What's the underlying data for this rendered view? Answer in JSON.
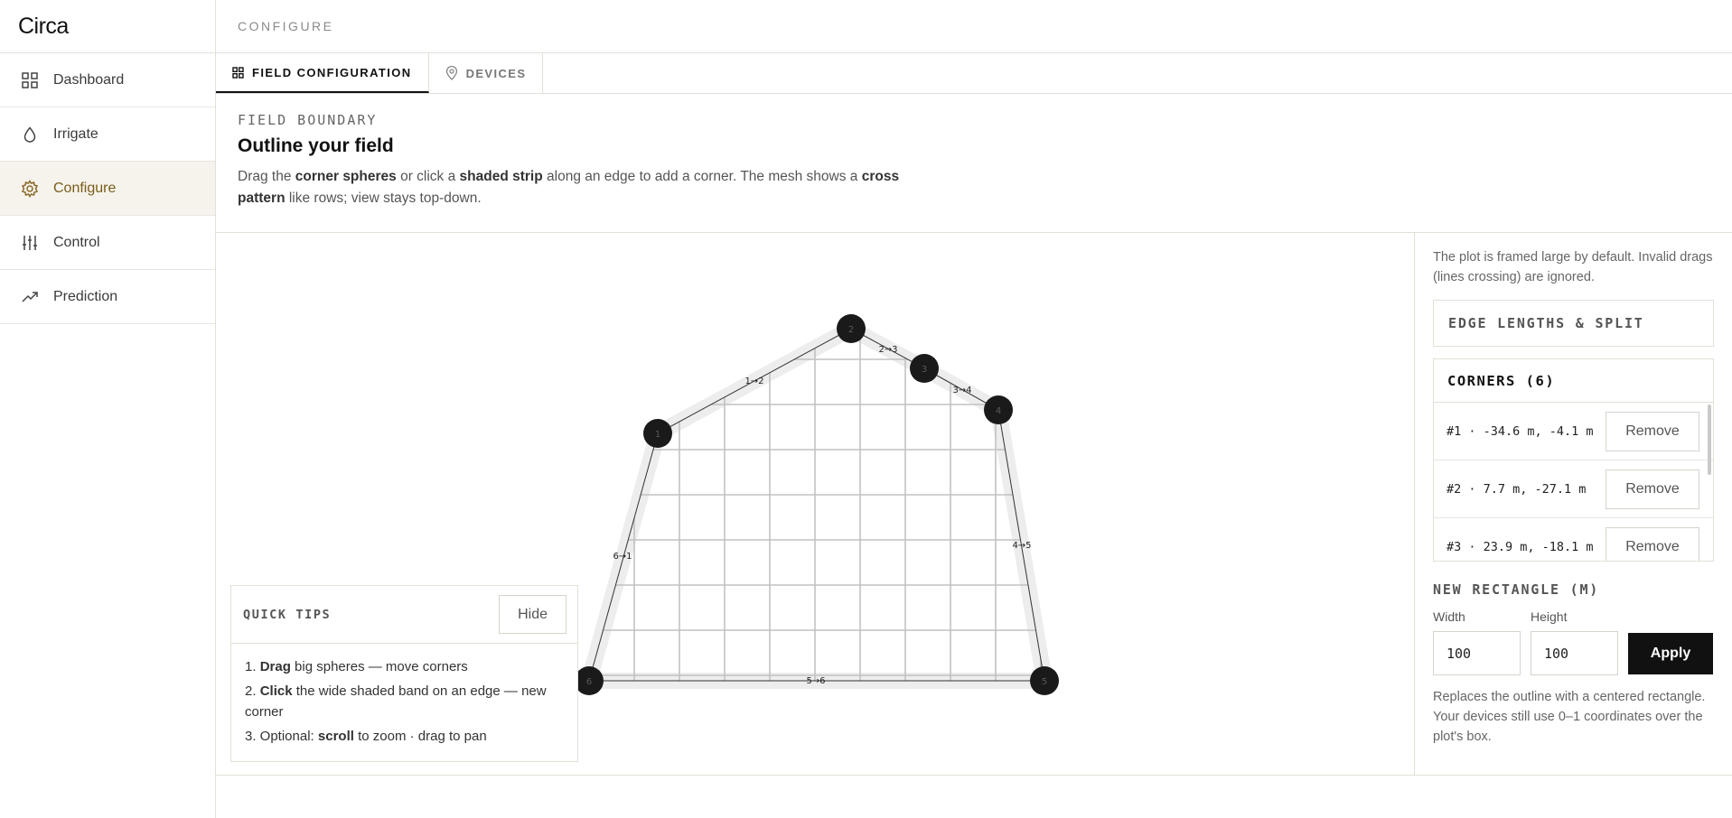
{
  "app": {
    "brand": "Circa"
  },
  "sidebar": {
    "items": [
      {
        "label": "Dashboard",
        "icon": "grid-icon"
      },
      {
        "label": "Irrigate",
        "icon": "droplet-icon"
      },
      {
        "label": "Configure",
        "icon": "gear-icon"
      },
      {
        "label": "Control",
        "icon": "sliders-icon"
      },
      {
        "label": "Prediction",
        "icon": "trending-up-icon"
      }
    ]
  },
  "topbar": {
    "title": "CONFIGURE"
  },
  "tabs": [
    {
      "label": "FIELD CONFIGURATION",
      "icon": "grid-icon"
    },
    {
      "label": "DEVICES",
      "icon": "map-pin-icon"
    }
  ],
  "header": {
    "eyebrow": "FIELD BOUNDARY",
    "title": "Outline your field",
    "desc_1": "Drag the ",
    "desc_2": "corner spheres",
    "desc_3": " or click a ",
    "desc_4": "shaded strip",
    "desc_5": " along an edge to add a corner. The mesh shows a ",
    "desc_6": "cross pattern",
    "desc_7": " like rows; view stays top-down."
  },
  "canvas": {
    "corner_labels": [
      "1",
      "2",
      "3",
      "4",
      "5",
      "6"
    ],
    "edge_labels": [
      "1→2",
      "2→3",
      "3→4",
      "4→5",
      "5→6",
      "6→1"
    ]
  },
  "tips": {
    "title": "QUICK TIPS",
    "hide_label": "Hide",
    "items": [
      {
        "num": "1. ",
        "bold": "Drag",
        "text": " big spheres — move corners"
      },
      {
        "num": "2. ",
        "bold": "Click",
        "text": " the wide shaded band on an edge — new corner"
      },
      {
        "num": "3. Optional: ",
        "bold": "scroll",
        "text": " to zoom · drag to pan"
      }
    ]
  },
  "panel": {
    "note": "The plot is framed large by default. Invalid drags (lines crossing) are ignored.",
    "edge_title": "EDGE LENGTHS & SPLIT",
    "corners_title": "CORNERS (6)",
    "corners": [
      {
        "label": "#1 · -34.6 m, -4.1 m",
        "action": "Remove"
      },
      {
        "label": "#2 · 7.7 m, -27.1 m",
        "action": "Remove"
      },
      {
        "label": "#3 · 23.9 m, -18.1 m",
        "action": "Remove"
      }
    ],
    "rect_title": "NEW RECTANGLE (M)",
    "width_label": "Width",
    "width_value": "100",
    "height_label": "Height",
    "height_value": "100",
    "apply_label": "Apply",
    "foot": "Replaces the outline with a centered rectangle. Your devices still use 0–1 coordinates over the plot's box."
  }
}
